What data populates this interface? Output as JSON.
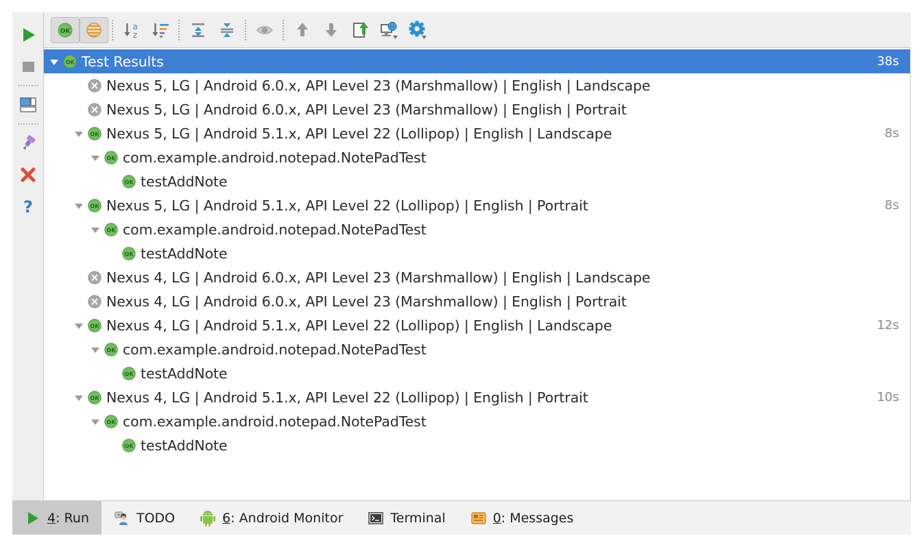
{
  "window": {
    "title": "Run"
  },
  "leftbar": {
    "items": [
      {
        "name": "rerun-button",
        "icon": "run-green-triangle-icon",
        "label": "Rerun"
      },
      {
        "name": "stop-button",
        "icon": "stop-square-icon",
        "label": "Stop"
      },
      {
        "separator": true
      },
      {
        "name": "layout-button",
        "icon": "layout-panels-icon",
        "label": "Layout"
      },
      {
        "separator": true
      },
      {
        "name": "pin-tab-button",
        "icon": "pin-icon",
        "label": "Pin Tab"
      },
      {
        "name": "close-button",
        "icon": "close-x-icon",
        "label": "Close"
      },
      {
        "name": "help-button",
        "icon": "question-mark-icon",
        "label": "Help"
      }
    ]
  },
  "toolbar": {
    "items": [
      {
        "name": "hide-passed-toggle",
        "icon": "ok-green-badge-icon",
        "label": "Hide Passed",
        "toggled": true
      },
      {
        "name": "show-ignored-toggle",
        "icon": "striped-sphere-icon",
        "label": "Show Ignored",
        "toggled": true
      },
      {
        "separator": true
      },
      {
        "name": "sort-alphabetically-button",
        "icon": "sort-a-z-icon",
        "label": "Sort Alphabetically"
      },
      {
        "name": "sort-by-duration-button",
        "icon": "sort-by-duration-icon",
        "label": "Sort by Duration"
      },
      {
        "separator": true
      },
      {
        "name": "expand-all-button",
        "icon": "expand-all-icon",
        "label": "Expand All"
      },
      {
        "name": "collapse-all-button",
        "icon": "collapse-all-icon",
        "label": "Collapse All"
      },
      {
        "separator": true
      },
      {
        "name": "track-running-test-button",
        "icon": "eye-icon",
        "label": "Track Running Test"
      },
      {
        "separator": true
      },
      {
        "name": "previous-failed-test-button",
        "icon": "arrow-up-icon",
        "label": "Previous Failed Test"
      },
      {
        "name": "next-failed-test-button",
        "icon": "arrow-down-icon",
        "label": "Next Failed Test"
      },
      {
        "name": "export-test-results-button",
        "icon": "export-page-icon",
        "label": "Export Test Results"
      },
      {
        "name": "open-in-browser-button",
        "icon": "monitor-globe-icon",
        "label": "Open in Browser"
      },
      {
        "name": "settings-button",
        "icon": "gear-icon",
        "label": "Settings"
      }
    ]
  },
  "tree": {
    "rows": [
      {
        "label": "Test Results",
        "duration": "38s",
        "indent": 0,
        "status": "passed",
        "expanded": true,
        "selected": true,
        "name": "tree-row-test-results"
      },
      {
        "label": "Nexus 5, LG | Android 6.0.x, API Level 23 (Marshmallow) | English | Landscape",
        "duration": "",
        "indent": 1,
        "status": "ignored",
        "expanded": null,
        "selected": false,
        "name": "tree-row-device"
      },
      {
        "label": "Nexus 5, LG | Android 6.0.x, API Level 23 (Marshmallow) | English | Portrait",
        "duration": "",
        "indent": 1,
        "status": "ignored",
        "expanded": null,
        "selected": false,
        "name": "tree-row-device"
      },
      {
        "label": "Nexus 5, LG | Android 5.1.x, API Level 22 (Lollipop) | English | Landscape",
        "duration": "8s",
        "indent": 1,
        "status": "passed",
        "expanded": true,
        "selected": false,
        "name": "tree-row-device"
      },
      {
        "label": "com.example.android.notepad.NotePadTest",
        "duration": "",
        "indent": 2,
        "status": "passed",
        "expanded": true,
        "selected": false,
        "name": "tree-row-test-class"
      },
      {
        "label": "testAddNote",
        "duration": "",
        "indent": 3,
        "status": "passed",
        "expanded": null,
        "selected": false,
        "name": "tree-row-test-method"
      },
      {
        "label": "Nexus 5, LG | Android 5.1.x, API Level 22 (Lollipop) | English | Portrait",
        "duration": "8s",
        "indent": 1,
        "status": "passed",
        "expanded": true,
        "selected": false,
        "name": "tree-row-device"
      },
      {
        "label": "com.example.android.notepad.NotePadTest",
        "duration": "",
        "indent": 2,
        "status": "passed",
        "expanded": true,
        "selected": false,
        "name": "tree-row-test-class"
      },
      {
        "label": "testAddNote",
        "duration": "",
        "indent": 3,
        "status": "passed",
        "expanded": null,
        "selected": false,
        "name": "tree-row-test-method"
      },
      {
        "label": "Nexus 4, LG | Android 6.0.x, API Level 23 (Marshmallow) | English | Landscape",
        "duration": "",
        "indent": 1,
        "status": "ignored",
        "expanded": null,
        "selected": false,
        "name": "tree-row-device"
      },
      {
        "label": "Nexus 4, LG | Android 6.0.x, API Level 23 (Marshmallow) | English | Portrait",
        "duration": "",
        "indent": 1,
        "status": "ignored",
        "expanded": null,
        "selected": false,
        "name": "tree-row-device"
      },
      {
        "label": "Nexus 4, LG | Android 5.1.x, API Level 22 (Lollipop) | English | Landscape",
        "duration": "12s",
        "indent": 1,
        "status": "passed",
        "expanded": true,
        "selected": false,
        "name": "tree-row-device"
      },
      {
        "label": "com.example.android.notepad.NotePadTest",
        "duration": "",
        "indent": 2,
        "status": "passed",
        "expanded": true,
        "selected": false,
        "name": "tree-row-test-class"
      },
      {
        "label": "testAddNote",
        "duration": "",
        "indent": 3,
        "status": "passed",
        "expanded": null,
        "selected": false,
        "name": "tree-row-test-method"
      },
      {
        "label": "Nexus 4, LG | Android 5.1.x, API Level 22 (Lollipop) | English | Portrait",
        "duration": "10s",
        "indent": 1,
        "status": "passed",
        "expanded": true,
        "selected": false,
        "name": "tree-row-device"
      },
      {
        "label": "com.example.android.notepad.NotePadTest",
        "duration": "",
        "indent": 2,
        "status": "passed",
        "expanded": true,
        "selected": false,
        "name": "tree-row-test-class"
      },
      {
        "label": "testAddNote",
        "duration": "",
        "indent": 3,
        "status": "passed",
        "expanded": null,
        "selected": false,
        "name": "tree-row-test-method"
      }
    ]
  },
  "statusbar": {
    "tabs": [
      {
        "name": "tab-run",
        "mnemonic": "4",
        "label": ": Run",
        "icon": "run-green-triangle-icon",
        "active": true
      },
      {
        "name": "tab-todo",
        "mnemonic": "",
        "label": "TODO",
        "icon": "todo-person-icon",
        "active": false
      },
      {
        "name": "tab-android-monitor",
        "mnemonic": "6",
        "label": ": Android Monitor",
        "icon": "android-robot-icon",
        "active": false
      },
      {
        "name": "tab-terminal",
        "mnemonic": "",
        "label": "Terminal",
        "icon": "terminal-icon",
        "active": false
      },
      {
        "name": "tab-messages",
        "mnemonic": "0",
        "label": ": Messages",
        "icon": "messages-icon",
        "active": false
      }
    ]
  },
  "colors": {
    "selection": "#3d7fd4",
    "passed_green": "#6fbf5f",
    "ignored_gray": "#9a9a9a",
    "toolbar_bg": "#efefef",
    "panel_bg": "#f2f2f2"
  }
}
